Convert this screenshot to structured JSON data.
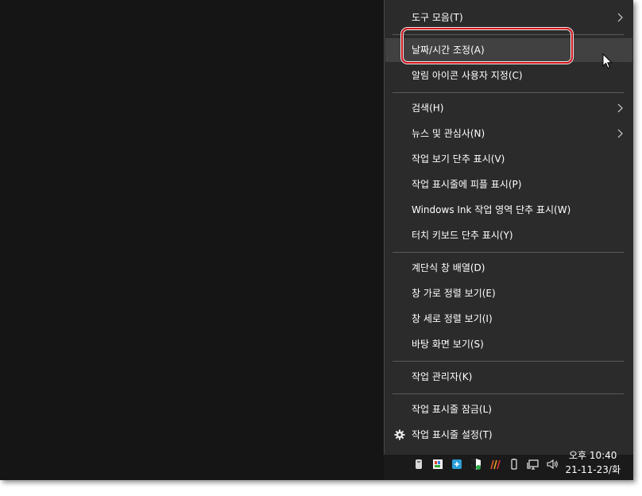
{
  "context_menu": {
    "items": [
      {
        "label": "도구 모음(T)",
        "submenu": true
      },
      {
        "label": "날짜/시간 조정(A)",
        "highlighted": true
      },
      {
        "label": "알림 아이콘 사용자 지정(C)"
      },
      {
        "label": "검색(H)",
        "submenu": true
      },
      {
        "label": "뉴스 및 관심사(N)",
        "submenu": true
      },
      {
        "label": "작업 보기 단추 표시(V)"
      },
      {
        "label": "작업 표시줄에 피플 표시(P)"
      },
      {
        "label": "Windows Ink 작업 영역 단추 표시(W)"
      },
      {
        "label": "터치 키보드 단추 표시(Y)"
      },
      {
        "label": "계단식 창 배열(D)"
      },
      {
        "label": "창 가로 정렬 보기(E)"
      },
      {
        "label": "창 세로 정렬 보기(I)"
      },
      {
        "label": "바탕 화면 보기(S)"
      },
      {
        "label": "작업 관리자(K)"
      },
      {
        "label": "작업 표시줄 잠금(L)"
      },
      {
        "label": "작업 표시줄 설정(T)",
        "icon": "gear-icon"
      }
    ]
  },
  "taskbar": {
    "clock_time": "오후 10:40",
    "clock_date": "21-11-23/화",
    "tray_icons": [
      "usb-drive-icon",
      "app-icon",
      "browser-icon",
      "security-shield-icon",
      "pen-icon",
      "battery-icon",
      "network-icon",
      "volume-icon"
    ]
  },
  "colors": {
    "menu_background": "#2b2b2b",
    "hover_background": "#414141",
    "annotation_red": "#d4141c",
    "desktop_background": "#151515"
  }
}
